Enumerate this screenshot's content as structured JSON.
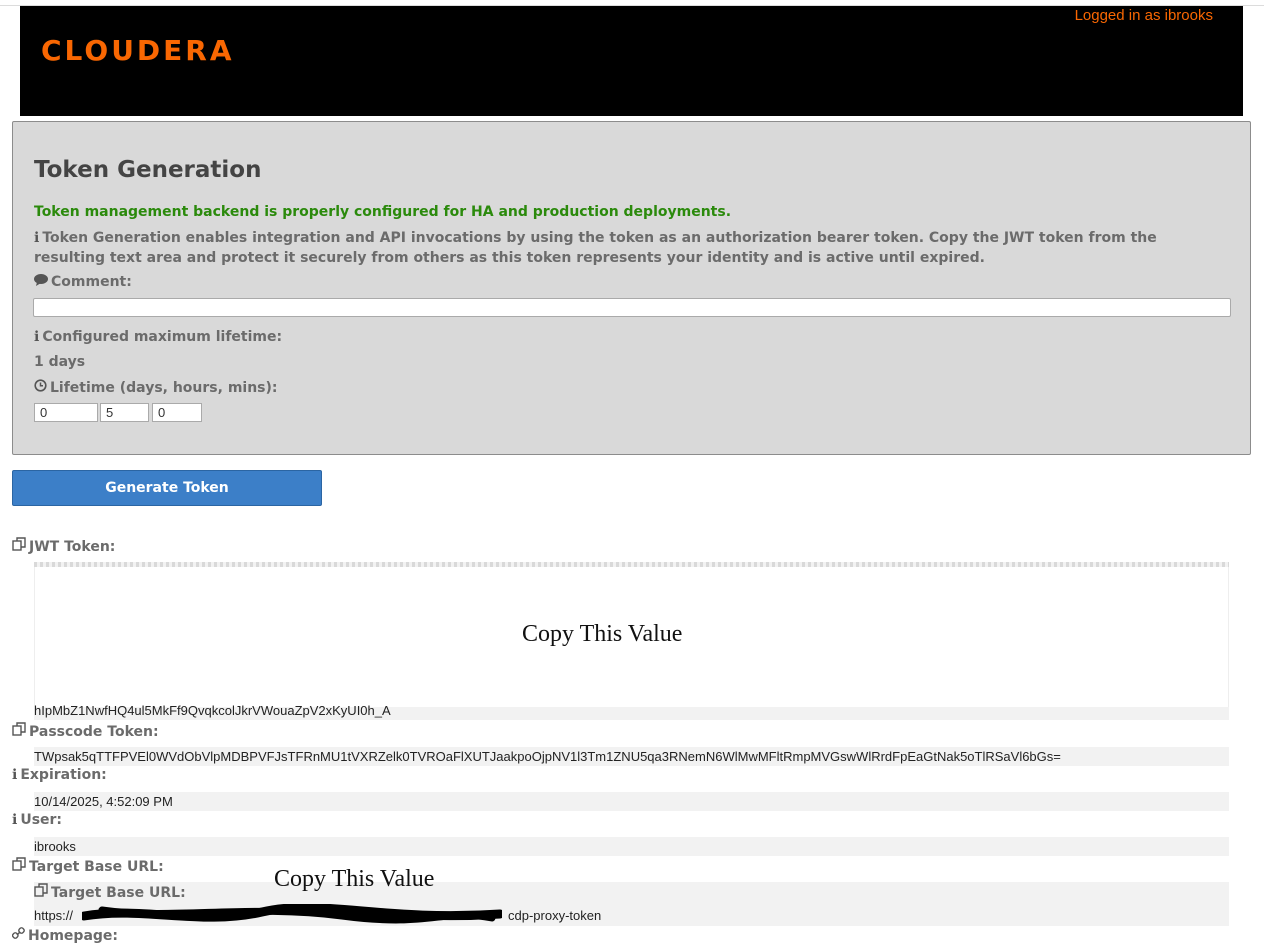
{
  "header": {
    "logo": "CLOUDERA",
    "logged_in": "Logged in as ibrooks",
    "colors": {
      "brand": "#f96702",
      "header_bg": "#000000"
    }
  },
  "panel": {
    "title": "Token Generation",
    "status_message": "Token management backend is properly configured for HA and production deployments.",
    "info_text": "Token Generation enables integration and API invocations by using the token as an authorization bearer token. Copy the JWT token from the resulting text area and protect it securely from others as this token represents your identity and is active until expired.",
    "comment_label": "Comment:",
    "comment_value": "",
    "max_lifetime_label": "Configured maximum lifetime:",
    "max_lifetime_value": "1 days",
    "lifetime_label": "Lifetime (days, hours, mins):",
    "lifetime_days": "0",
    "lifetime_hours": "5",
    "lifetime_mins": "0"
  },
  "actions": {
    "generate_label": "Generate Token"
  },
  "results": {
    "jwt_label": "JWT Token:",
    "jwt_tail": "hIpMbZ1NwfHQ4ul5MkFf9QvqkcolJkrVWouaZpV2xKyUI0h_A",
    "copy_overlay": "Copy This Value",
    "passcode_label": "Passcode Token:",
    "passcode_value": "TWpsak5qTTFPVEl0WVdObVlpMDBPVFJsTFRnMU1tVXRZelk0TVROaFlXUTJaakpoOjpNV1l3Tm1ZNU5qa3RNemN6WlMwMFltRmpMVGswWlRrdFpEaGtNak5oTlRSaVl6bGs=",
    "expiration_label": "Expiration:",
    "expiration_value": "10/14/2025, 4:52:09 PM",
    "user_label": "User:",
    "user_value": "ibrooks",
    "target_base_label": "Target Base URL:",
    "target_base_inner_label": "Target Base URL:",
    "target_base_prefix": "https://",
    "target_base_suffix": "cdp-proxy-token",
    "homepage_label": "Homepage:"
  },
  "icons": {
    "info": "info-icon",
    "comment": "comment-icon",
    "clock": "clock-icon",
    "copy": "copy-icon",
    "link": "link-icon"
  }
}
